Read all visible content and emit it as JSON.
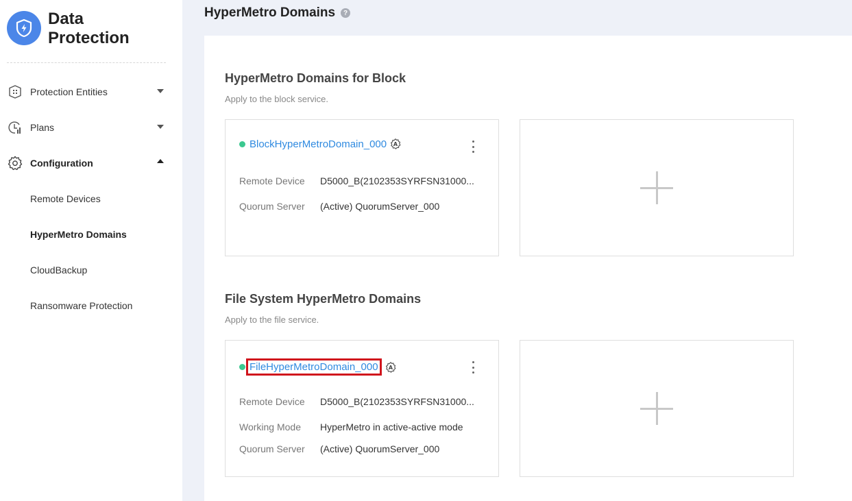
{
  "app": {
    "title": "Data Protection"
  },
  "sidebar": {
    "items": [
      {
        "label": "Protection Entities",
        "icon": "entities-icon",
        "expanded": false
      },
      {
        "label": "Plans",
        "icon": "plans-icon",
        "expanded": false
      },
      {
        "label": "Configuration",
        "icon": "gear-icon",
        "expanded": true
      }
    ],
    "subitems": [
      {
        "label": "Remote Devices"
      },
      {
        "label": "HyperMetro Domains",
        "active": true
      },
      {
        "label": "CloudBackup"
      },
      {
        "label": "Ransomware Protection"
      }
    ]
  },
  "header": {
    "title": "HyperMetro Domains",
    "help": "?"
  },
  "block_section": {
    "title": "HyperMetro Domains for Block",
    "subtitle": "Apply to the block service.",
    "card": {
      "name": "BlockHyperMetroDomain_000",
      "status_color": "#3cc890",
      "rows": [
        {
          "key": "Remote Device",
          "value": "D5000_B(2102353SYRFSN31000..."
        },
        {
          "key": "Quorum Server",
          "value": "(Active) QuorumServer_000"
        }
      ]
    }
  },
  "file_section": {
    "title": "File System HyperMetro Domains",
    "subtitle": "Apply to the file service.",
    "card": {
      "name": "FileHyperMetroDomain_000",
      "status_color": "#3cc890",
      "highlighted": true,
      "highlight_color": "#d0141c",
      "rows": [
        {
          "key": "Remote Device",
          "value": "D5000_B(2102353SYRFSN31000..."
        },
        {
          "key": "Working Mode",
          "value": "HyperMetro in active-active mode"
        },
        {
          "key": "Quorum Server",
          "value": "(Active) QuorumServer_000"
        }
      ]
    }
  },
  "colors": {
    "accent": "#2f8ae0",
    "brand": "#4b86e8",
    "status_ok": "#3cc890"
  }
}
